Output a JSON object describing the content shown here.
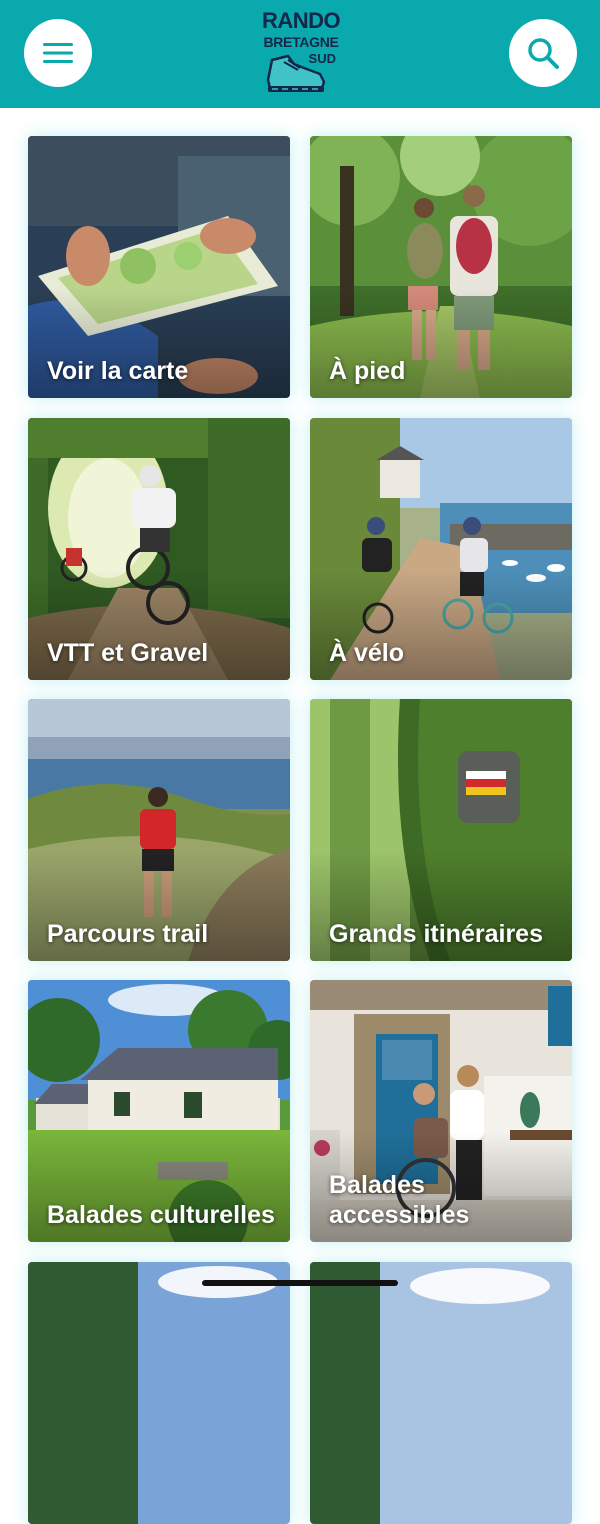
{
  "header": {
    "logo_line1": "RANDO",
    "logo_line2": "BRETAGNE",
    "logo_line3": "SUD",
    "background_color": "#0aa9ad",
    "menu_icon": "hamburger-menu-icon",
    "search_icon": "search-icon"
  },
  "tiles": [
    {
      "label": "Voir la carte"
    },
    {
      "label": "À pied"
    },
    {
      "label": "VTT et Gravel"
    },
    {
      "label": "À vélo"
    },
    {
      "label": "Parcours trail"
    },
    {
      "label": "Grands itinéraires"
    },
    {
      "label": "Balades culturelles"
    },
    {
      "label": "Balades accessibles"
    }
  ]
}
